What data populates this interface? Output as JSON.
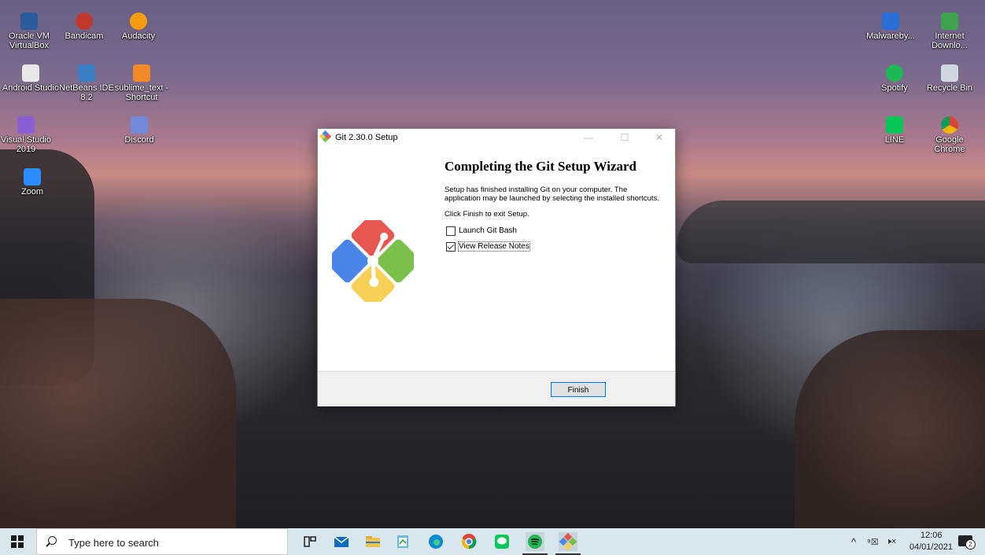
{
  "desktop_icons": [
    {
      "label": "Oracle VM VirtualBox",
      "icon": "virtualbox-icon",
      "color": "#2b5d9c"
    },
    {
      "label": "Bandicam",
      "icon": "bandicam-icon",
      "color": "#c0392b"
    },
    {
      "label": "Audacity",
      "icon": "audacity-icon",
      "color": "#f39c12"
    },
    {
      "label": "Android Studio",
      "icon": "android-studio-icon",
      "color": "#e8e8e8"
    },
    {
      "label": "NetBeans IDE 8.2",
      "icon": "netbeans-icon",
      "color": "#3b7fc4"
    },
    {
      "label": "sublime_text - Shortcut",
      "icon": "sublime-text-icon",
      "color": "#f28b26"
    },
    {
      "label": "Visual Studio 2019",
      "icon": "visual-studio-icon",
      "color": "#8a5fd4"
    },
    {
      "label": "Discord",
      "icon": "discord-icon",
      "color": "#7289da"
    },
    {
      "label": "Zoom",
      "icon": "zoom-icon",
      "color": "#2d8cff"
    },
    {
      "label": "Malwareby...",
      "icon": "malwarebytes-icon",
      "color": "#2a6fd6"
    },
    {
      "label": "Internet Downlo...",
      "icon": "internet-download-manager-icon",
      "color": "#3fa34d"
    },
    {
      "label": "Spotify",
      "icon": "spotify-icon",
      "color": "#1db954"
    },
    {
      "label": "Recycle Bin",
      "icon": "recycle-bin-icon",
      "color": "#cfd8e0"
    },
    {
      "label": "LINE",
      "icon": "line-icon",
      "color": "#06c755"
    },
    {
      "label": "Google Chrome",
      "icon": "chrome-icon",
      "color": "#db4437"
    }
  ],
  "window": {
    "title": "Git 2.30.0 Setup",
    "minimize": "—",
    "maximize": "☐",
    "close": "✕",
    "heading": "Completing the Git Setup Wizard",
    "paragraph1": "Setup has finished installing Git on your computer. The application may be launched by selecting the installed shortcuts.",
    "paragraph2": "Click Finish to exit Setup.",
    "checkboxes": [
      {
        "label": "Launch Git Bash",
        "checked": false
      },
      {
        "label": "View Release Notes",
        "checked": true
      }
    ],
    "finish_label": "Finish",
    "logo_colors": [
      "#e8574f",
      "#7ac04a",
      "#f6d155",
      "#4a86e8"
    ]
  },
  "taskbar": {
    "search_placeholder": "Type here to search",
    "pinned": [
      "task-view-icon",
      "mail-icon",
      "file-explorer-icon",
      "notepad-icon",
      "edge-icon",
      "chrome-icon",
      "line-icon",
      "spotify-icon",
      "git-setup-icon"
    ],
    "tray": {
      "chevron": "^",
      "keyboard": "⁹☒",
      "volume": "🕨×",
      "time": "12:06",
      "date": "04/01/2021",
      "notifications_count": "2"
    }
  }
}
